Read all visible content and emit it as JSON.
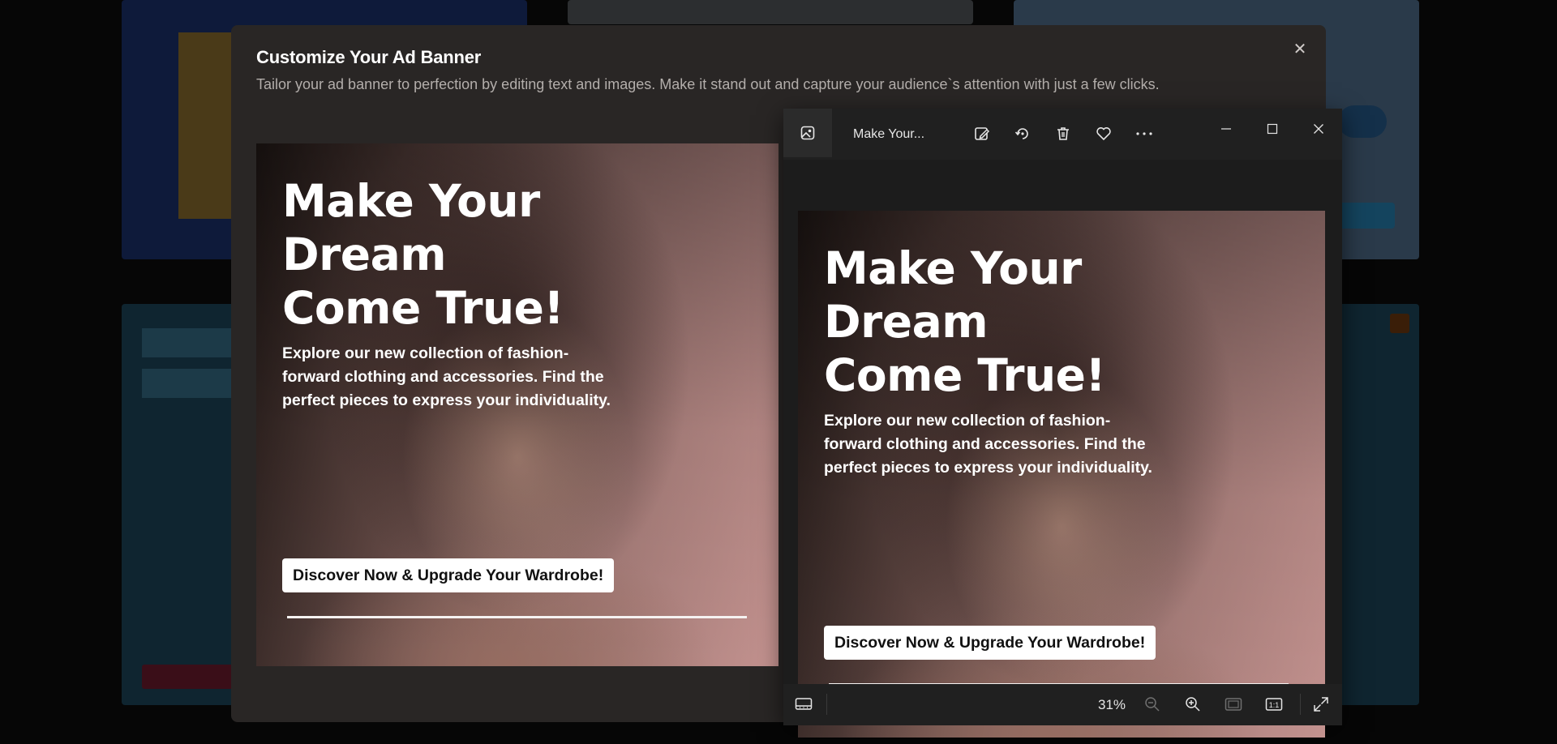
{
  "dialog": {
    "title": "Customize Your Ad Banner",
    "subtitle": "Tailor your ad banner to perfection by editing text and images. Make it stand out and capture your audience`s attention with just a few clicks.",
    "close_label": "✕"
  },
  "banner": {
    "headline_lines": [
      "Make Your",
      "Dream",
      "Come True!"
    ],
    "body": "Explore our new collection of fashion-forward clothing and accessories. Find the perfect pieces to express your individuality.",
    "cta": "Discover Now & Upgrade Your Wardrobe!"
  },
  "viewer": {
    "filename": "Make Your...",
    "zoom": "31%",
    "toolbar_icons": [
      "edit-image-icon",
      "rotate-icon",
      "delete-icon",
      "favorite-icon",
      "more-icon"
    ],
    "window_controls": [
      "minimize-icon",
      "maximize-icon",
      "close-icon"
    ],
    "status_icons": [
      "filmstrip-icon",
      "zoom-out-icon",
      "zoom-in-icon",
      "fit-to-window-icon",
      "actual-size-icon",
      "fullscreen-icon"
    ],
    "actual_size_label": "1:1"
  },
  "colors": {
    "dialog_bg": "#292625",
    "viewer_bg": "#1c1c1c",
    "cta_bg": "#ffffff"
  }
}
